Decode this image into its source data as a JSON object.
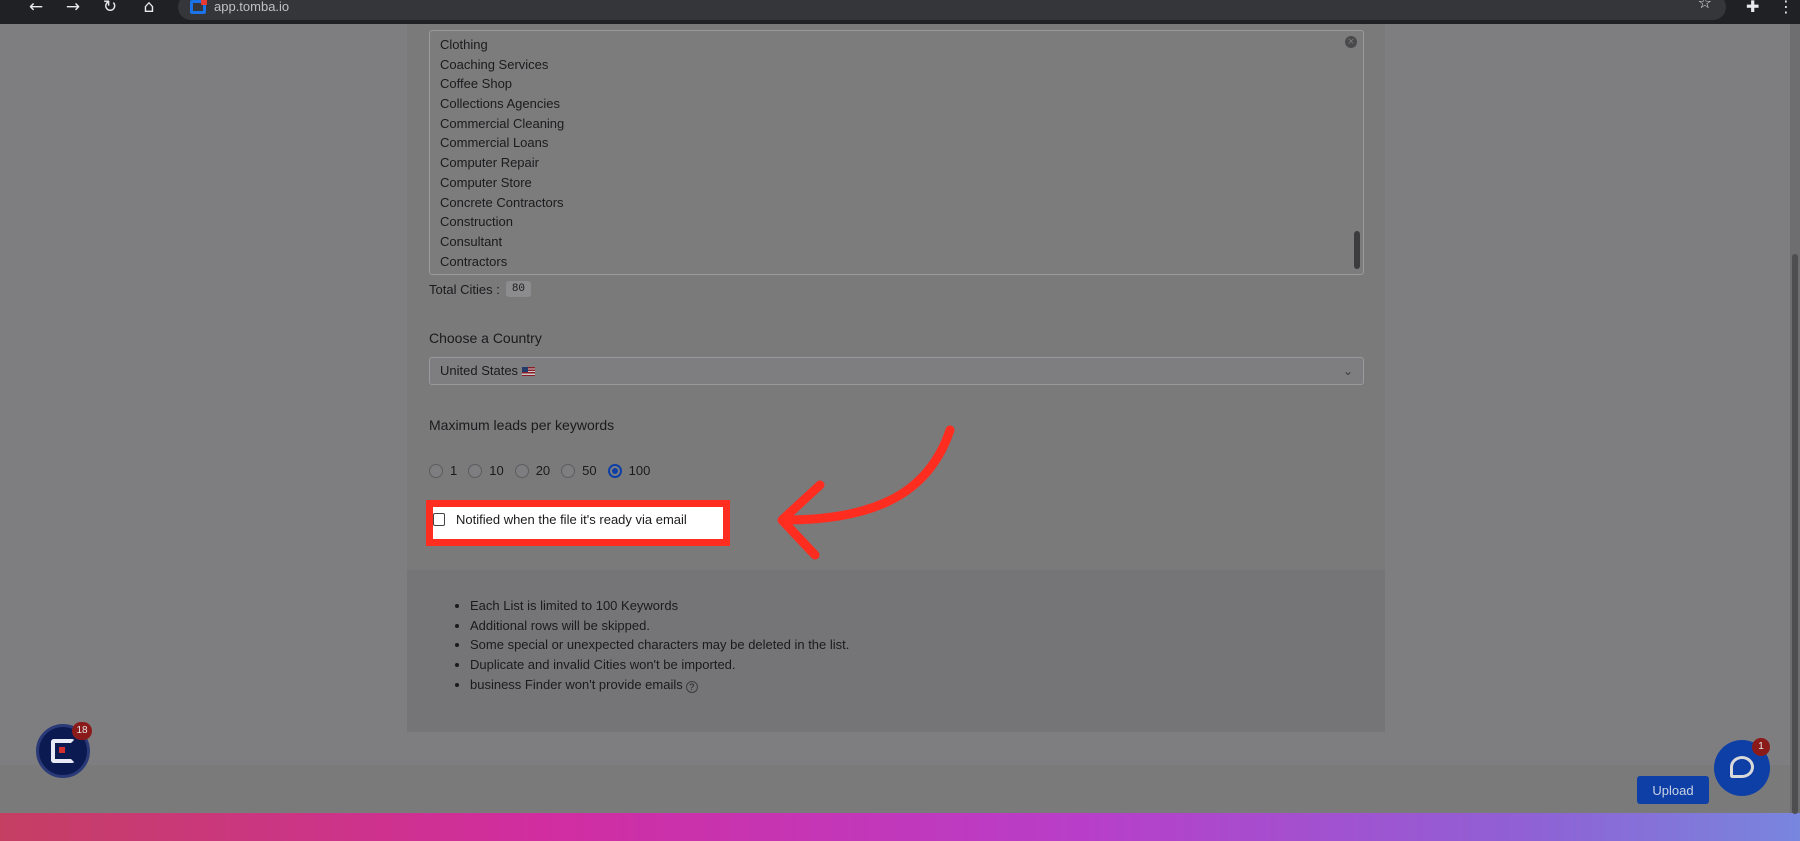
{
  "browser": {
    "url": "app.tomba.io",
    "back_icon": "arrow-left-icon",
    "forward_icon": "arrow-right-icon",
    "reload_icon": "reload-icon",
    "home_icon": "home-icon"
  },
  "form": {
    "cities": [
      "Clothing",
      "Coaching Services",
      "Coffee Shop",
      "Collections Agencies",
      "Commercial Cleaning",
      "Commercial Loans",
      "Computer Repair",
      "Computer Store",
      "Concrete Contractors",
      "Construction",
      "Consultant",
      "Contractors"
    ],
    "total_cities_label": "Total Cities :",
    "total_cities_value": "80",
    "country_label": "Choose a Country",
    "country_value": "United States",
    "leads_label": "Maximum leads per keywords",
    "leads_options": [
      "1",
      "10",
      "20",
      "50",
      "100"
    ],
    "leads_selected": "100",
    "notify_label": "Notified when the file it's ready via email"
  },
  "notes": [
    "Each List is limited to 100 Keywords",
    "Additional rows will be skipped.",
    "Some special or unexpected characters may be deleted in the list.",
    "Duplicate and invalid Cities won't be imported.",
    "business Finder won't provide emails"
  ],
  "footer": {
    "upload_label": "Upload"
  },
  "widgets": {
    "tomba_count": "18",
    "chat_count": "1"
  },
  "colors": {
    "primary": "#0d3fa6",
    "highlight": "#ff2d1f"
  }
}
